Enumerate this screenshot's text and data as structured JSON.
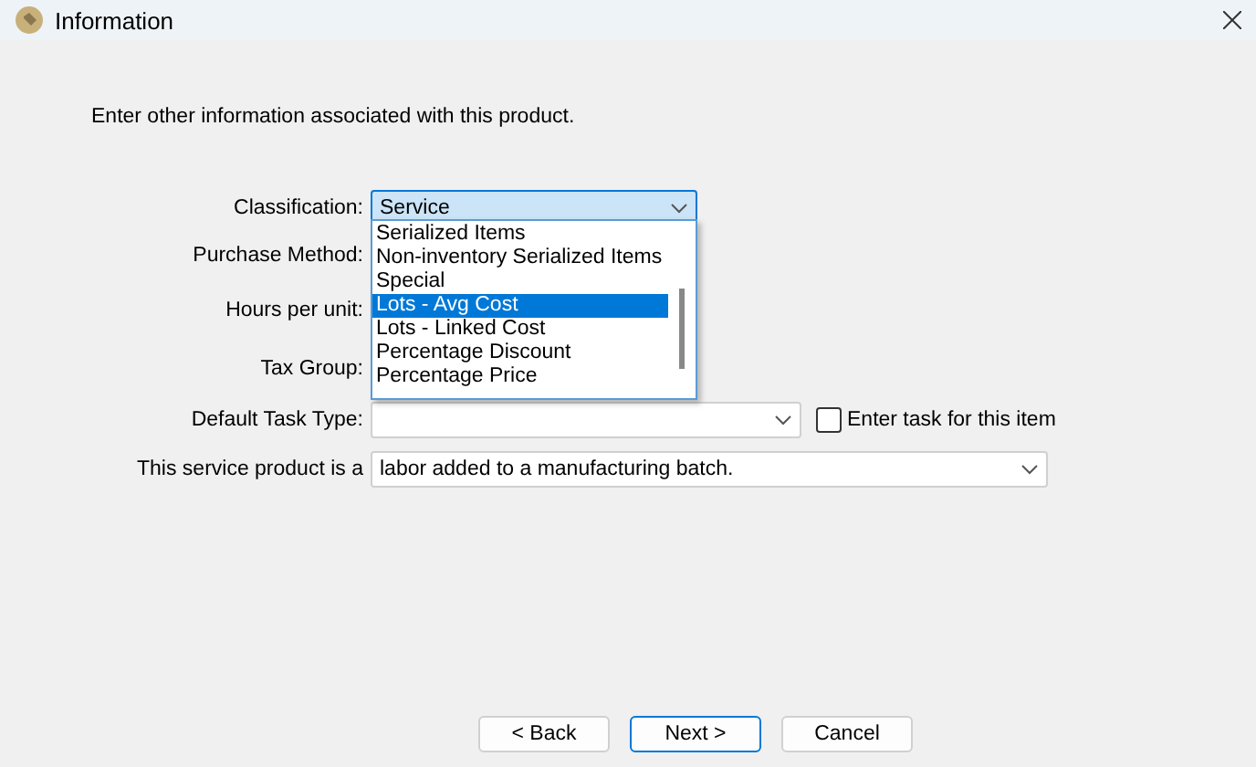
{
  "window": {
    "title": "Information"
  },
  "intro": "Enter other information associated with this product.",
  "classification": {
    "label": "Classification:",
    "value": "Service",
    "expanded": true,
    "options": [
      {
        "label": "Serialized Items",
        "selected": false
      },
      {
        "label": "Non-inventory Serialized Items",
        "selected": false
      },
      {
        "label": "Special",
        "selected": false
      },
      {
        "label": "Lots - Avg Cost",
        "selected": true
      },
      {
        "label": "Lots - Linked Cost",
        "selected": false
      },
      {
        "label": "Percentage Discount",
        "selected": false
      },
      {
        "label": "Percentage Price",
        "selected": false
      }
    ]
  },
  "hidden_rows": [
    {
      "label": "Purchase Method:"
    },
    {
      "label": "Hours per unit:"
    },
    {
      "label": "Tax Group:"
    }
  ],
  "default_task_type": {
    "label": "Default Task Type:",
    "checkbox": {
      "label": "Enter task for this item",
      "checked": false
    }
  },
  "service_product": {
    "label": "This service product is a",
    "value": "labor added to a manufacturing batch."
  },
  "buttons": [
    {
      "label": "< Back",
      "default": false
    },
    {
      "label": "Next >",
      "default": true
    },
    {
      "label": "Cancel",
      "default": false
    }
  ]
}
